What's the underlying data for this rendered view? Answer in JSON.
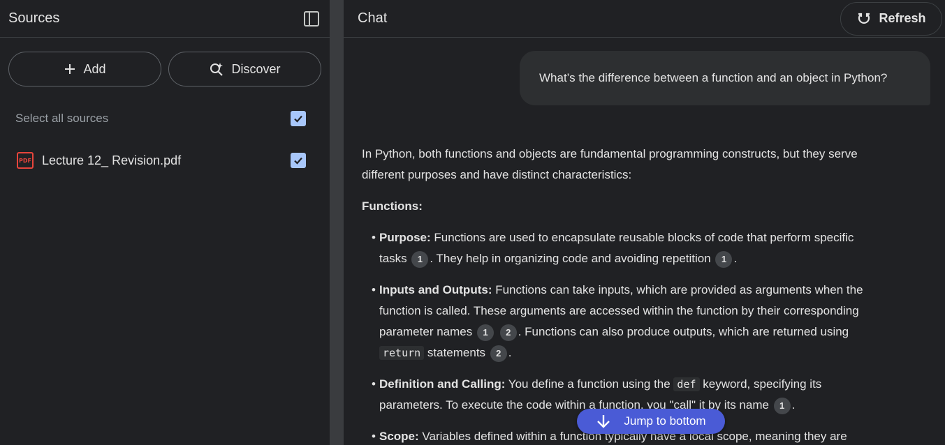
{
  "sources_panel": {
    "title": "Sources",
    "add_label": "Add",
    "discover_label": "Discover",
    "select_all_label": "Select all sources",
    "select_all_checked": true,
    "items": [
      {
        "name": "Lecture 12_ Revision.pdf",
        "type_badge": "PDF",
        "checked": true
      }
    ]
  },
  "chat_panel": {
    "title": "Chat",
    "refresh_label": "Refresh",
    "user_message": "What’s the difference between a function and an object in Python?",
    "answer": {
      "intro": "In Python, both functions and objects are fundamental programming constructs, but they serve different purposes and have distinct characteristics:",
      "section_heading": "Functions:",
      "bullets": [
        {
          "term": "Purpose:",
          "t1": " Functions are used to encapsulate reusable blocks of code that perform specific tasks ",
          "c1": "1",
          "t2": ". They help in organizing code and avoiding repetition ",
          "c2": "1",
          "t3": "."
        },
        {
          "term": "Inputs and Outputs:",
          "t1": " Functions can take inputs, which are provided as arguments when the function is called. These arguments are accessed within the function by their corresponding parameter names ",
          "c1": "1",
          "c2": "2",
          "t2": ". Functions can also produce outputs, which are returned using ",
          "code": "return",
          "t3": " statements ",
          "c3": "2",
          "t4": "."
        },
        {
          "term": "Definition and Calling:",
          "t1": " You define a function using the ",
          "code": "def",
          "t2": " keyword, specifying its parameters. To execute the code within a function, you \"call\" it by its name ",
          "c1": "1",
          "t3": "."
        },
        {
          "term": "Scope:",
          "t1": " Variables defined within a function typically have a local scope, meaning they are"
        }
      ]
    },
    "jump_label": "Jump to bottom"
  },
  "colors": {
    "panel_bg": "#202124",
    "gutter_bg": "#3a3c3f",
    "accent_button": "#4a5bd6",
    "checkbox": "#a8c7fa",
    "pdf_red": "#e8453c"
  }
}
